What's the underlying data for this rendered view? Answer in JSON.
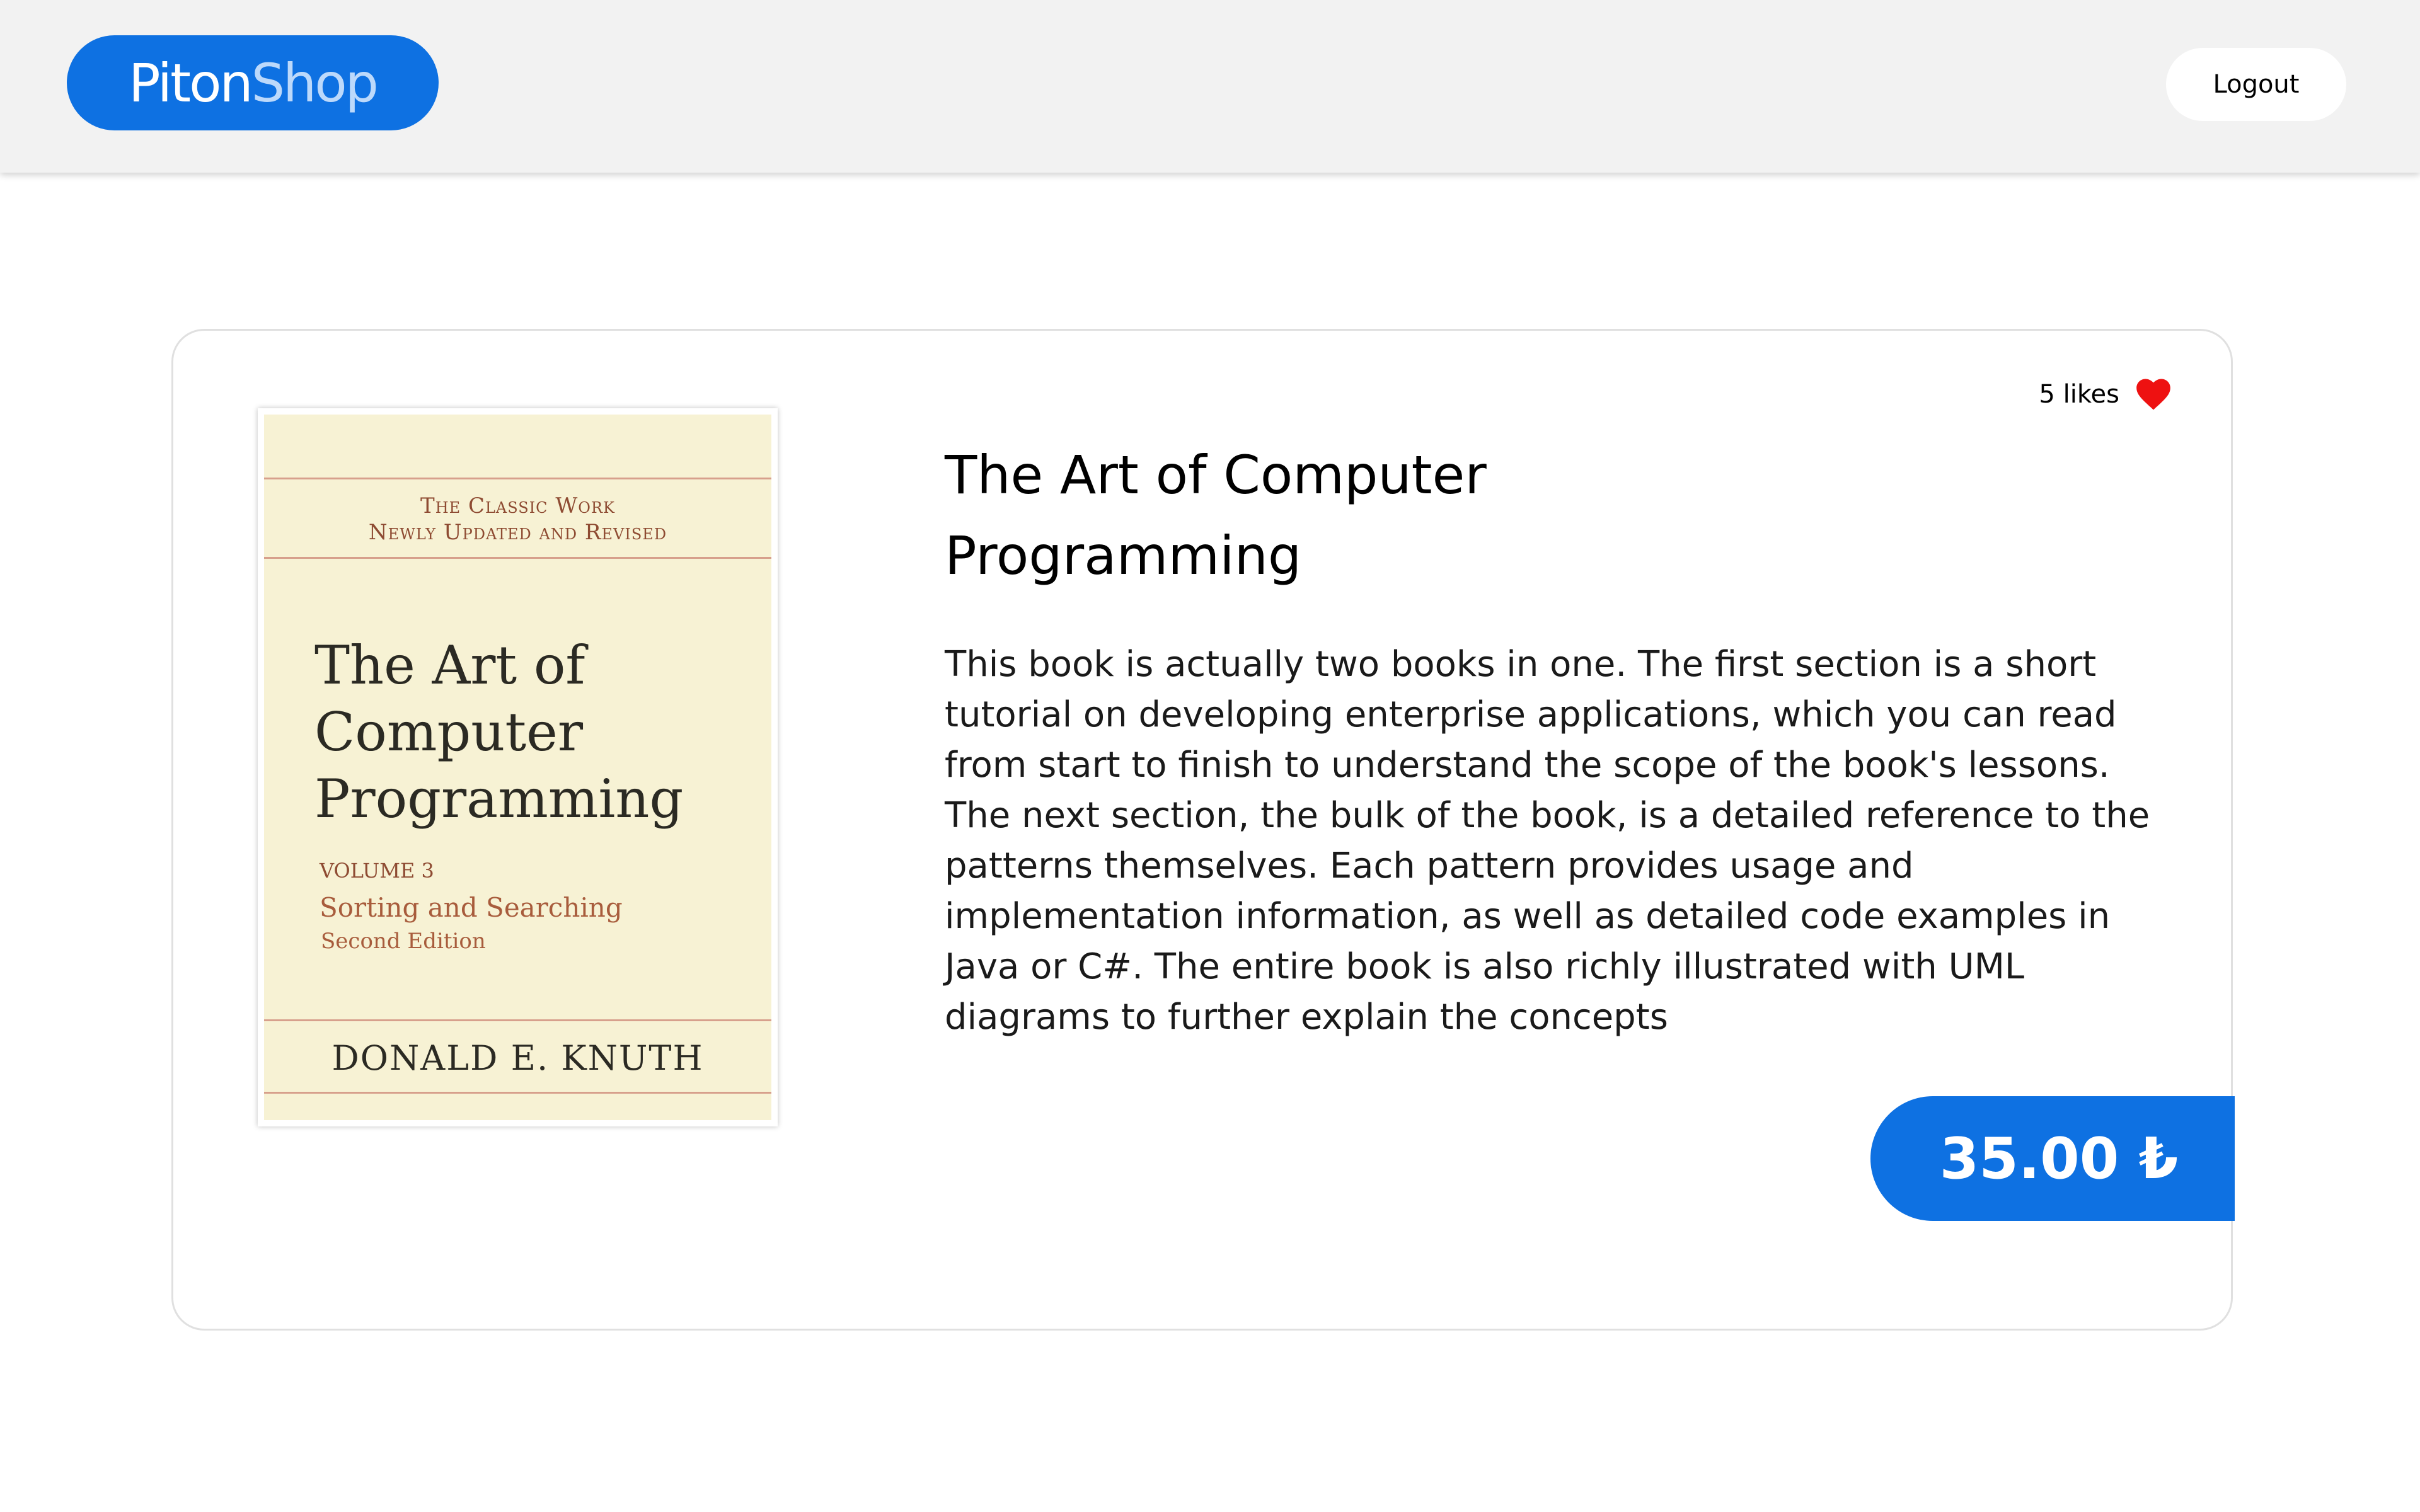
{
  "header": {
    "logo_part1": "Piton",
    "logo_part2": "Shop",
    "logout_label": "Logout"
  },
  "product": {
    "likes": "5 likes",
    "title": "The Art of Computer Programming",
    "description": "This book is actually two books in one. The first section is a short tutorial on developing enterprise applications, which you can read from start to finish to understand the scope of the book's lessons. The next section, the bulk of the book, is a detailed reference to the patterns themselves. Each pattern provides usage and implementation information, as well as detailed code examples in Java or C#. The entire book is also richly illustrated with UML diagrams to further explain the concepts",
    "price": "35.00 ₺",
    "cover": {
      "tagline_line1": "The Classic Work",
      "tagline_line2": "Newly Updated and Revised",
      "title_line1": "The Art of",
      "title_line2": "Computer",
      "title_line3": "Programming",
      "volume": "VOLUME 3",
      "subtitle": "Sorting and Searching",
      "edition": "Second Edition",
      "author": "DONALD E. KNUTH"
    }
  },
  "colors": {
    "brand_blue": "#0e71e2",
    "heart_red": "#ee1111",
    "header_bg": "#f2f2f2"
  },
  "icons": {
    "likes": "heart-icon"
  }
}
